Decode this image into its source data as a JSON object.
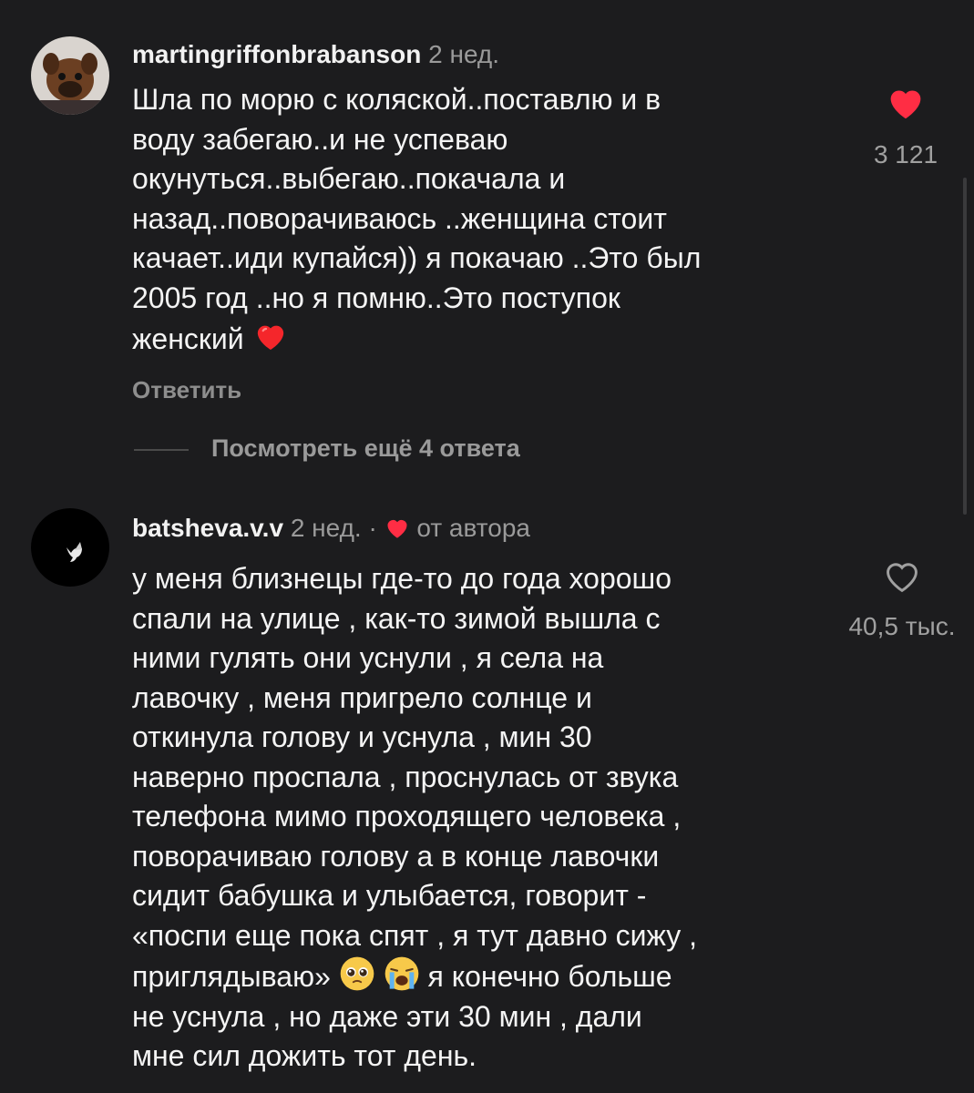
{
  "comments": [
    {
      "username": "martingriffonbrabanson",
      "time": "2 нед.",
      "text_lines": [
        "Шла по морю с коляской..поставлю и в",
        "воду забегаю..и не успеваю",
        "окунуться..выбегаю..покачала и",
        "назад..поворачиваюсь ..женщина стоит",
        "качает..иди купайся)) я покачаю ..Это был",
        "2005 год ..но я помню..Это поступок",
        "женский"
      ],
      "trailing_emoji": "red-heart-emoji",
      "reply_label": "Ответить",
      "like_count": "3 121",
      "liked": true,
      "more_replies_label": "Посмотреть ещё 4 ответа"
    },
    {
      "username": "batsheva.v.v",
      "time": "2 нед.",
      "separator": "·",
      "author_tag": "от автора",
      "text_lines": [
        "у меня близнецы где-то до года хорошо",
        "спали на улице , как-то зимой вышла с",
        "ними гулять они уснули , я села на",
        "лавочку , меня пригрело солнце и",
        "откинула голову и уснула , мин 30",
        "наверно проспала , проснулась от звука",
        "телефона мимо проходящего человека ,",
        "поворачиваю голову а в конце лавочки",
        "сидит бабушка и улыбается, говорит -",
        "«поспи еще пока спят , я тут давно сижу ,",
        "приглядываю»",
        "не уснула , но даже эти 30 мин , дали",
        "мне сил дожить тот день."
      ],
      "line_11_suffix": " я конечно больше",
      "emojis": [
        "pleading-face-emoji",
        "loudly-crying-face-emoji"
      ],
      "like_count": "40,5 тыс.",
      "liked": false
    }
  ],
  "colors": {
    "background": "#1c1c1e",
    "like_red": "#ff2d44",
    "muted": "#9a9a9a"
  }
}
